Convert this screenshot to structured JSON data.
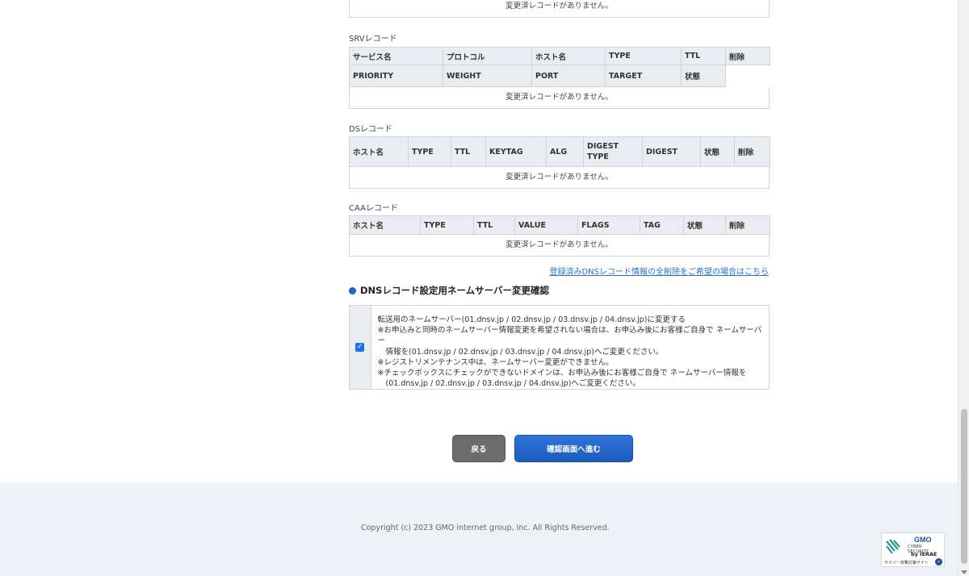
{
  "empty_message": "変更済レコードがありません。",
  "srv": {
    "label": "SRVレコード",
    "header_row1": [
      "サービス名",
      "プロトコル",
      "ホスト名",
      "TYPE",
      "TTL",
      "削除"
    ],
    "header_row2": [
      "PRIORITY",
      "WEIGHT",
      "PORT",
      "TARGET",
      "状態"
    ]
  },
  "ds": {
    "label": "DSレコード",
    "headers": [
      "ホスト名",
      "TYPE",
      "TTL",
      "KEYTAG",
      "ALG",
      "DIGEST TYPE",
      "DIGEST",
      "状態",
      "削除"
    ]
  },
  "caa": {
    "label": "CAAレコード",
    "headers": [
      "ホスト名",
      "TYPE",
      "TTL",
      "VALUE",
      "FLAGS",
      "TAG",
      "状態",
      "削除"
    ]
  },
  "delete_all_link": "登録済みDNSレコード情報の全削除をご希望の場合はこちら",
  "nameserver": {
    "heading": "DNSレコード設定用ネームサーバー変更確認",
    "checked": true,
    "line1": "転送用のネームサーバー(01.dnsv.jp / 02.dnsv.jp / 03.dnsv.jp / 04.dnsv.jp)に変更する",
    "note1a": "※お申込みと同時のネームサーバー情報変更を希望されない場合は、お申込み後にお客様ご自身で ネームサーバー",
    "note1b": "情報を(01.dnsv.jp / 02.dnsv.jp / 03.dnsv.jp / 04.dnsv.jp)へご変更ください。",
    "note2": "※レジストリメンテナンス中は、ネームサーバー変更ができません。",
    "note3a": "※チェックボックスにチェックができないドメインは、お申込み後にお客様ご自身で ネームサーバー情報を",
    "note3b": "(01.dnsv.jp / 02.dnsv.jp / 03.dnsv.jp / 04.dnsv.jp)へご変更ください。"
  },
  "buttons": {
    "back": "戻る",
    "next": "確認画面へ進む"
  },
  "footer": {
    "copyright": "Copyright (c) 2023 GMO internet group, Inc. All Rights Reserved."
  },
  "badge": {
    "brand": "GMO",
    "line1": "CYBER SECURITY",
    "line2": "by IERAE",
    "line3": "サイバー攻撃対策サイト"
  }
}
